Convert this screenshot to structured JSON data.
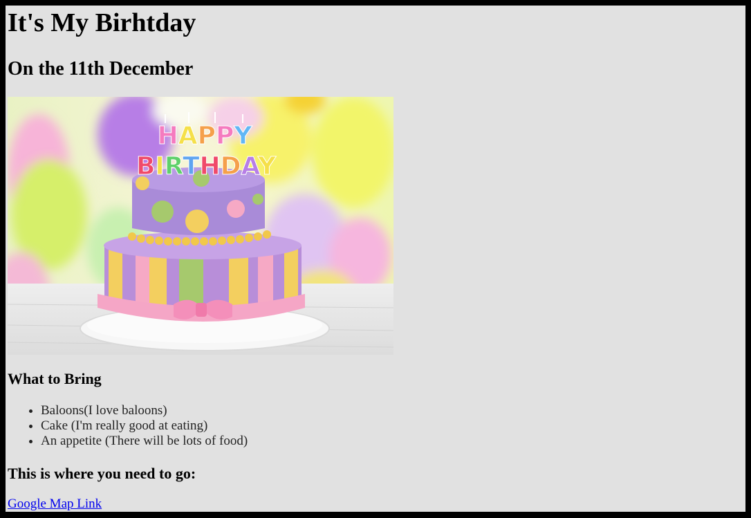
{
  "header": {
    "title": "It's My Birhtday",
    "subtitle": "On the 11th December"
  },
  "hero_image": {
    "alt": "Birthday cake",
    "colors": {
      "lavender": "#a98bd8",
      "yellow": "#f2d66a",
      "green": "#a7c86a",
      "pink": "#f2a7c8",
      "plate": "#f3f3f3"
    },
    "candle_letters_top": "HAPPY",
    "candle_letters_bottom": "BIRTHDAY"
  },
  "bring": {
    "title": "What to Bring",
    "items": [
      "Baloons(I love baloons)",
      "Cake (I'm really good at eating)",
      "An appetite (There will be lots of food)"
    ]
  },
  "directions": {
    "title": "This is where you need to go:",
    "link_label": "Google Map Link"
  }
}
